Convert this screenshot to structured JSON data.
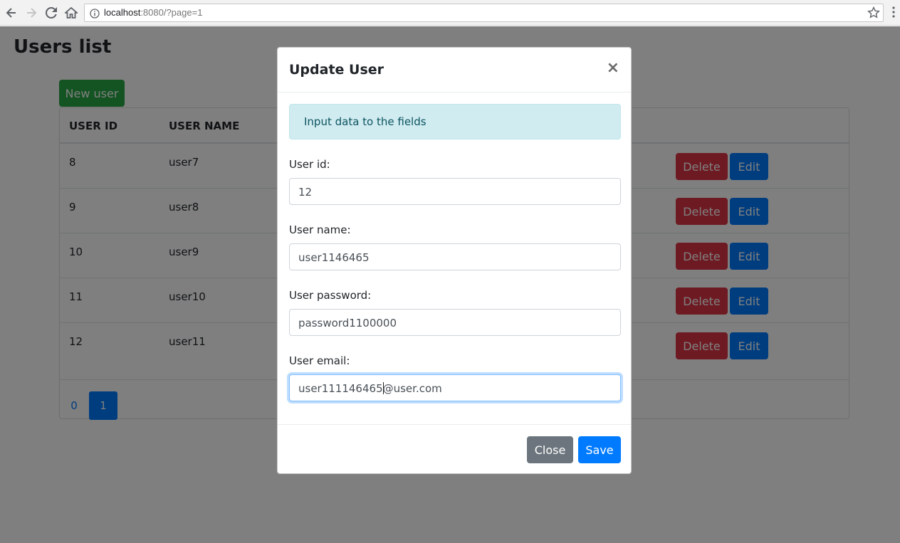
{
  "browser": {
    "url_host": "localhost",
    "url_rest": ":8080/?page=1"
  },
  "page": {
    "title": "Users list",
    "new_user_label": "New user",
    "columns": [
      "USER ID",
      "USER NAME"
    ],
    "rows": [
      {
        "id": "8",
        "name": "user7"
      },
      {
        "id": "9",
        "name": "user8"
      },
      {
        "id": "10",
        "name": "user9"
      },
      {
        "id": "11",
        "name": "user10"
      },
      {
        "id": "12",
        "name": "user11"
      }
    ],
    "delete_label": "Delete",
    "edit_label": "Edit",
    "pages": [
      "0",
      "1"
    ],
    "active_page": "1"
  },
  "modal": {
    "title": "Update User",
    "close_symbol": "×",
    "alert": "Input data to the fields",
    "fields": {
      "id_label": "User id:",
      "id_value": "12",
      "name_label": "User name:",
      "name_value": "user1146465",
      "password_label": "User password:",
      "password_value": "password1100000",
      "email_label": "User email:",
      "email_value_before_caret": "user111146465",
      "email_value_after_caret": "@user.com"
    },
    "close_label": "Close",
    "save_label": "Save"
  },
  "colors": {
    "primary": "#007bff",
    "danger": "#dc3545",
    "success": "#28a745",
    "secondary": "#6c757d",
    "alert_bg": "#d1ecf1"
  },
  "icons": [
    "back-icon",
    "forward-icon",
    "reload-icon",
    "home-icon",
    "info-icon",
    "star-icon",
    "menu-icon"
  ]
}
